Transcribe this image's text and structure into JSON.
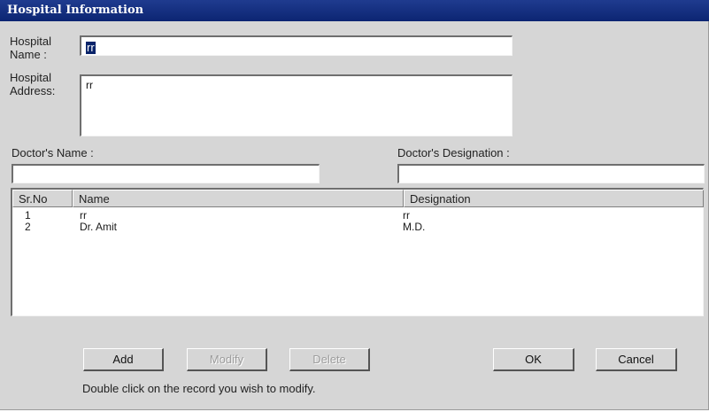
{
  "window": {
    "title": "Hospital Information"
  },
  "form": {
    "hospital_name_label_line1": "Hospital",
    "hospital_name_label_line2": "Name :",
    "hospital_name_value": "rr",
    "hospital_address_label_line1": "Hospital",
    "hospital_address_label_line2": "Address:",
    "hospital_address_value": "rr",
    "doctor_name_label": "Doctor's Name :",
    "doctor_name_value": "",
    "doctor_designation_label": "Doctor's Designation :",
    "doctor_designation_value": ""
  },
  "table": {
    "columns": [
      "Sr.No",
      "Name",
      "Designation"
    ],
    "rows": [
      [
        "1",
        "rr",
        "rr"
      ],
      [
        "2",
        "Dr. Amit",
        "M.D."
      ]
    ]
  },
  "buttons": {
    "add": "Add",
    "modify": "Modify",
    "delete": "Delete",
    "ok": "OK",
    "cancel": "Cancel"
  },
  "hint": "Double click on the record you wish to modify."
}
